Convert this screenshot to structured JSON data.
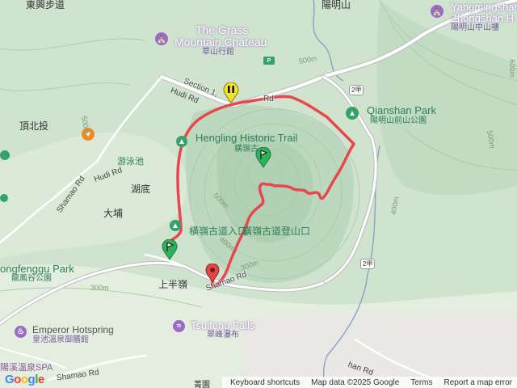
{
  "colors": {
    "terrain": "#cfe3cf",
    "terrain_light": "#e6efe2",
    "terrain_dark": "#b5d2b8",
    "track": "#e8474c",
    "road": "#ffffff",
    "road_edge": "#bdbdbd",
    "stream": "#7a93b8",
    "poi_purple": "#9a6cc4",
    "park_green": "#34a36b",
    "food_orange": "#f08a24",
    "start_green": "#2fb35a",
    "end_red": "#e04848",
    "pause_yellow": "#f6e12a"
  },
  "labels": {
    "top_left_fragment": "東興步道",
    "top_center_fragment": "陽明山",
    "grass_mountain_en1": "The Grass",
    "grass_mountain_en2": "Mountain Chateau",
    "grass_mountain_zh": "草山行館",
    "yangmingshan_en1": "Yangmingshan",
    "yangmingshan_en2": "Zhongshan H",
    "yangmingshan_zh": "陽明山中山樓",
    "qianshan_en": "Qianshan Park",
    "qianshan_zh": "陽明山前山公園",
    "hengling_en": "Hengling Historic Trail",
    "hengling_zh_short": "橫嶺古",
    "hengling_entrance_zh": "橫嶺古道入口",
    "hengling_trailhead_zh": "橫嶺古道登山口",
    "dingbeitou": "頂北投",
    "pool": "游泳池",
    "hudi": "湖底",
    "dapu": "大埔",
    "shangbanling": "上半嶺",
    "longfenggu_en": "ongfenggu Park",
    "longfenggu_zh": "龍鳳谷公園",
    "emperor_en": "Emperor Hotspring",
    "emperor_zh": "皇池溫泉御膳館",
    "tsuifeng_en": "Tsuifeng Falls",
    "tsuifeng_zh": "翠峰瀑布",
    "spa_zh": "陽溪溫泉SPA",
    "bottom_fragment": "菁園"
  },
  "roads": {
    "section1": "Section 1,",
    "section1_rd": "Rd",
    "hudi_rd_1": "Hudi Rd",
    "hudi_rd_2": "Hudi Rd",
    "shamao_rd_1": "Shamao Rd",
    "shamao_rd_2": "Shamao Rd",
    "shamao_rd_3": "Shamao Rd",
    "shan_rd": "han Rd",
    "shield_2a_top": "2甲",
    "shield_2a_bottom": "2甲"
  },
  "elevations": {
    "e500_top": "500m",
    "e500_right": "500m",
    "e600_right": "600m",
    "e400_right": "400m",
    "e500_left": "500m",
    "e300_bottom": "300m",
    "e300_left": "300m",
    "e500_ring": "500m",
    "e400_ring": "400m"
  },
  "footer": {
    "logo": "Google",
    "keyboard": "Keyboard shortcuts",
    "mapdata": "Map data ©2025 Google",
    "terms": "Terms",
    "report": "Report a map error"
  },
  "icons": {
    "grass_mountain": "museum-icon",
    "yangmingshan": "museum-icon",
    "qianshan": "park-icon",
    "hengling": "hiking-icon",
    "hengling_entrance": "hiking-icon",
    "restaurant": "restaurant-icon",
    "emperor": "spa-icon",
    "tsuifeng": "waterfall-icon",
    "start": "start-flag-pin",
    "end": "end-pin",
    "pause": "pause-pin",
    "waypoint": "waypoint-flag-pin"
  }
}
